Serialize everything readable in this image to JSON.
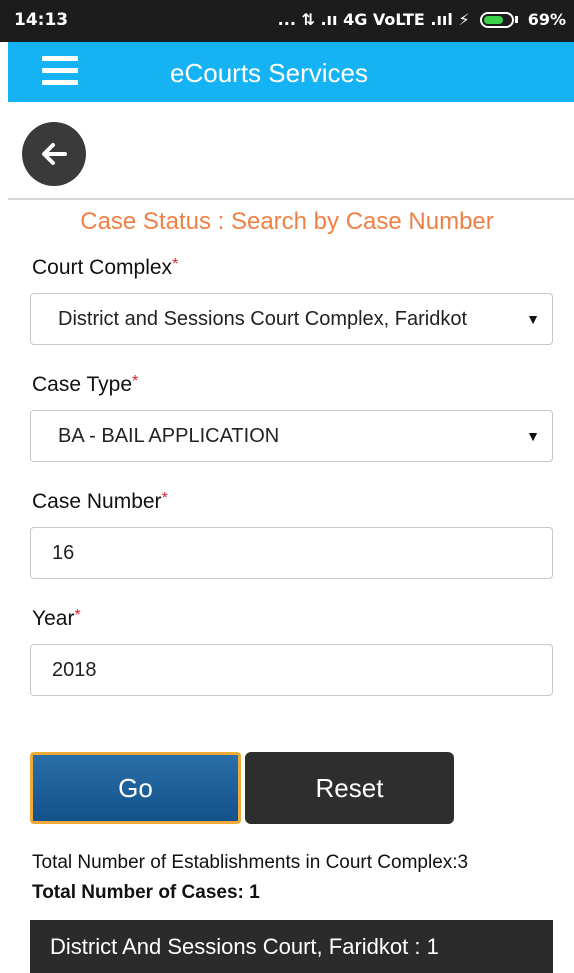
{
  "status_bar": {
    "time": "14:13",
    "indicators": "... ⇅ .ıı 4G VoLTE .ııl ⚡",
    "battery": "69%"
  },
  "app_bar": {
    "title": "eCourts Services"
  },
  "section_title": "Case Status : Search by Case Number",
  "form": {
    "court_complex": {
      "label": "Court Complex",
      "required_mark": "*",
      "value": "District and Sessions Court Complex, Faridkot"
    },
    "case_type": {
      "label": "Case Type",
      "required_mark": "*",
      "value": "BA - BAIL APPLICATION"
    },
    "case_number": {
      "label": "Case Number",
      "required_mark": "*",
      "value": "16"
    },
    "year": {
      "label": "Year",
      "required_mark": "*",
      "value": "2018"
    }
  },
  "buttons": {
    "go": "Go",
    "reset": "Reset"
  },
  "summary": {
    "establishments": "Total Number of Establishments in Court Complex:3",
    "cases": "Total Number of Cases: 1"
  },
  "results": [
    {
      "label": "District And Sessions Court, Faridkot : 1"
    }
  ],
  "colors": {
    "app_bar": "#16b3f4",
    "section_title": "#f08044",
    "required": "#e0202a",
    "go_button": "#13528a",
    "go_border": "#f1a93a",
    "dark": "#2b2b2b"
  }
}
